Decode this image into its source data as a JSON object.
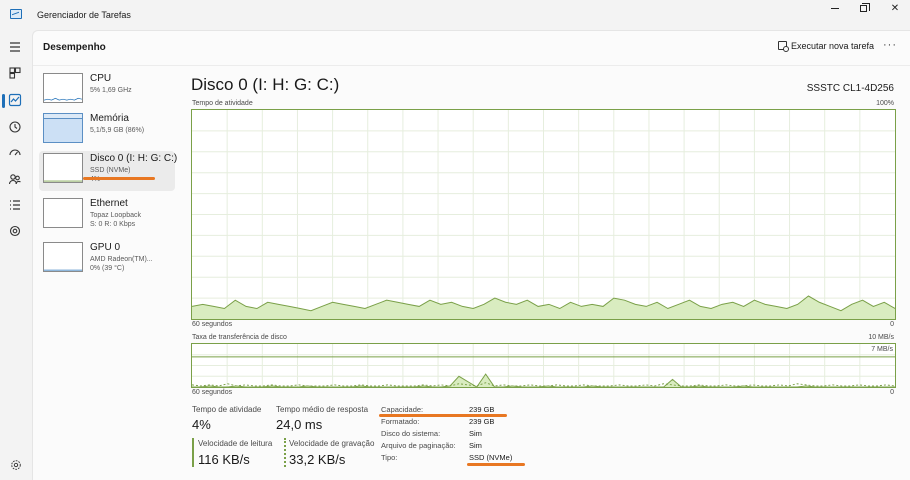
{
  "window": {
    "title": "Gerenciador de Tarefas"
  },
  "header": {
    "title": "Desempenho",
    "run_task_label": "Executar nova tarefa",
    "more_label": "···"
  },
  "nav": {
    "items": [
      "menu-icon",
      "processes-icon",
      "performance-icon",
      "history-icon",
      "startup-icon",
      "users-icon",
      "details-icon",
      "services-icon"
    ],
    "settings": "gear-icon"
  },
  "resources": [
    {
      "name": "CPU",
      "line1": "5% 1,69 GHz",
      "line2": ""
    },
    {
      "name": "Memória",
      "line1": "5,1/5,9 GB (86%)",
      "line2": ""
    },
    {
      "name": "Disco 0 (I: H: G: C:)",
      "line1": "SSD (NVMe)",
      "line2": "4%"
    },
    {
      "name": "Ethernet",
      "line1": "Topaz Loopback",
      "line2": "S: 0 R: 0 Kbps"
    },
    {
      "name": "GPU 0",
      "line1": "AMD Radeon(TM)...",
      "line2": "0% (39 °C)"
    }
  ],
  "detail": {
    "title": "Disco 0 (I: H: G: C:)",
    "model": "SSSTC CL1-4D256",
    "graph1": {
      "label": "Tempo de atividade",
      "max_label": "100%",
      "time_label": "60 segundos",
      "min_label": "0",
      "values": [
        6,
        7,
        6,
        5,
        9,
        6,
        5,
        8,
        7,
        6,
        5,
        4,
        6,
        8,
        7,
        6,
        5,
        7,
        9,
        8,
        7,
        6,
        9,
        7,
        8,
        6,
        5,
        7,
        10,
        8,
        7,
        9,
        6,
        7,
        5,
        8,
        6,
        7,
        6,
        10,
        9,
        7,
        6,
        8,
        5,
        7,
        9,
        6,
        5,
        7,
        8,
        6,
        9,
        7,
        6,
        5,
        7,
        11,
        8,
        6,
        4,
        7,
        9,
        6,
        8,
        5
      ]
    },
    "graph2": {
      "label": "Taxa de transferência de disco",
      "max_label": "10 MB/s",
      "sub_max_label": "7 MB/s",
      "time_label": "60 segundos",
      "min_label": "0",
      "read_values": [
        0,
        0,
        1,
        0,
        0,
        1,
        0,
        0,
        0,
        1,
        0,
        0,
        0,
        1,
        0,
        0,
        0,
        0,
        0,
        1,
        0,
        0,
        0,
        0,
        0,
        0,
        1,
        0,
        0,
        1,
        10,
        5,
        0,
        12,
        0,
        0,
        1,
        0,
        0,
        0,
        1,
        0,
        0,
        0,
        0,
        1,
        0,
        0,
        0,
        0,
        0,
        0,
        0,
        0,
        7,
        0,
        0,
        1,
        0,
        0,
        0,
        0,
        1,
        0,
        0,
        0,
        0,
        0,
        0,
        1,
        0,
        0,
        0,
        0,
        0,
        0,
        0,
        0,
        0,
        0
      ],
      "write_values": [
        2,
        1,
        2,
        1,
        3,
        1,
        2,
        1,
        1,
        2,
        1,
        1,
        2,
        1,
        1,
        1,
        2,
        1,
        1,
        2,
        1,
        1,
        2,
        1,
        1,
        1,
        2,
        1,
        2,
        1,
        3,
        2,
        1,
        4,
        1,
        2,
        1,
        1,
        2,
        1,
        1,
        2,
        1,
        1,
        2,
        1,
        1,
        1,
        2,
        1,
        1,
        2,
        1,
        3,
        2,
        1,
        1,
        2,
        1,
        1,
        2,
        1,
        1,
        2,
        1,
        1,
        2,
        1,
        3,
        2,
        1,
        1,
        2,
        1,
        1,
        2,
        1,
        1,
        2,
        1
      ]
    },
    "stats": {
      "active_time_label": "Tempo de atividade",
      "active_time_value": "4%",
      "avg_response_label": "Tempo médio de resposta",
      "avg_response_value": "24,0 ms",
      "read_speed_label": "Velocidade de leitura",
      "read_speed_value": "116 KB/s",
      "write_speed_label": "Velocidade de gravação",
      "write_speed_value": "33,2 KB/s"
    },
    "properties": [
      {
        "key": "Capacidade:",
        "value": "239 GB"
      },
      {
        "key": "Formatado:",
        "value": "239 GB"
      },
      {
        "key": "Disco do sistema:",
        "value": "Sim"
      },
      {
        "key": "Arquivo de paginação:",
        "value": "Sim"
      },
      {
        "key": "Tipo:",
        "value": "SSD (NVMe)"
      }
    ]
  },
  "colors": {
    "accent": "#1e6fb8",
    "disk_graph_line": "#7aa048",
    "disk_graph_fill": "#d9ecc0",
    "annotation_orange": "#e87722"
  }
}
